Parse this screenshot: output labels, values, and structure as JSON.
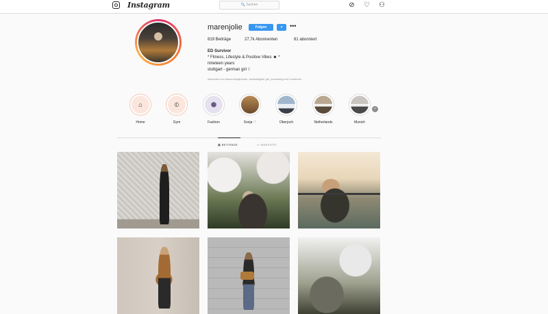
{
  "topbar": {
    "wordmark": "Instagram",
    "search_placeholder": "🔍 Suchen",
    "icons": [
      "instagram-glyph-icon",
      "compass-icon",
      "heart-icon",
      "person-icon"
    ]
  },
  "profile": {
    "username": "marenjolie",
    "follow_label": "Folgen",
    "dropdown_label": "▾",
    "more_label": "•••",
    "stats": {
      "posts": "819 Beiträge",
      "followers": "27,7k Abonnenten",
      "following": "81 abonniert"
    },
    "bio": {
      "name": "ED Survivor",
      "line1": "* Fitness, Lifestyle & Positive Vibes ☻ *",
      "line2": "nineteen years",
      "line3": "stuttgart - german girl ☾",
      "followed_by": "Abonniert von bloesomingthemie, lesbisfinglisli, girl_lesomefrg und 4 weiteren"
    },
    "accent_color": "#3897f0"
  },
  "highlights": [
    {
      "label": "Home",
      "icon": "home-icon"
    },
    {
      "label": "Gym",
      "icon": "dumbbell-icon"
    },
    {
      "label": "Fashion",
      "icon": "fashion-photo"
    },
    {
      "label": "Sonja ♡",
      "icon": "sonja-photo"
    },
    {
      "label": "Oberjoch",
      "icon": "oberjoch-photo"
    },
    {
      "label": "Netherlands",
      "icon": "netherlands-photo"
    },
    {
      "label": "Munich",
      "icon": "munich-photo"
    }
  ],
  "tabs": {
    "posts": "BEITRÄGE",
    "tagged": "MARKIERT"
  }
}
